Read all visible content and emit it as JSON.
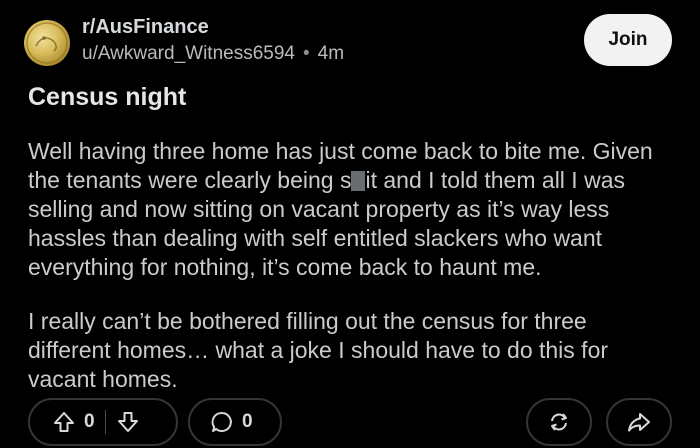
{
  "post": {
    "subreddit": "r/AusFinance",
    "author": "u/Awkward_Witness6594",
    "separator": "•",
    "age": "4m",
    "join_label": "Join",
    "title": "Census night",
    "body_p1_a": "Well having three home has just come back to bite me. Given the tenants were clearly being s",
    "body_p1_b": "it and I told them all I was selling and now sitting on vacant property as it’s way less hassles than dealing with self entitled slackers who want everything for nothing, it’s come back to haunt me.",
    "body_p2": "I really can’t be bothered filling out the census for three different homes… what a joke I should have to do this for vacant homes."
  },
  "actions": {
    "vote_count": "0",
    "comment_count": "0"
  },
  "icons": {
    "upvote": "arrow-up-icon",
    "downvote": "arrow-down-icon",
    "comment": "comment-bubble-icon",
    "award": "crosspost-icon",
    "share": "share-icon"
  }
}
